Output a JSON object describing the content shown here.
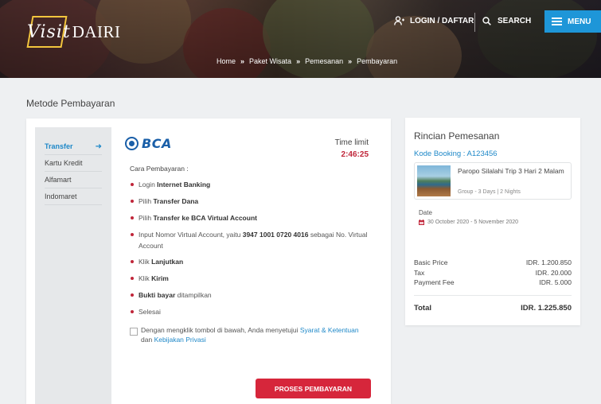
{
  "header": {
    "logo_visit": "Visit",
    "logo_dairi": "DAIRI",
    "login_label": "LOGIN / DAFTAR",
    "search_label": "SEARCH",
    "menu_label": "MENU"
  },
  "breadcrumb": [
    "Home",
    "Paket Wisata",
    "Pemesanan",
    "Pembayaran"
  ],
  "page_title": "Metode Pembayaran",
  "payment": {
    "tabs": [
      {
        "label": "Transfer",
        "active": true
      },
      {
        "label": "Kartu Kredit",
        "active": false
      },
      {
        "label": "Alfamart",
        "active": false
      },
      {
        "label": "Indomaret",
        "active": false
      }
    ],
    "bank_logo": "BCA",
    "time_limit_label": "Time limit",
    "time_limit_value": "2:46:25",
    "instructions_title": "Cara Pembayaran :",
    "agree_prefix": "Dengan mengklik tombol di bawah, Anda menyetujui",
    "agree_link1": "Syarat & Ketentuan",
    "agree_mid": "dan",
    "agree_link2": "Kebijakan Privasi",
    "submit_label": "PROSES PEMBAYARAN"
  },
  "summary": {
    "title": "Rincian Pemesanan",
    "booking_code": "Kode Booking : A123456",
    "trip_name": "Paropo Silalahi Trip 3 Hari 2 Malam",
    "trip_group": "Group - 3 Days | 2 Nights",
    "date_label": "Date",
    "date_value": "30 October 2020 - 5 November 2020",
    "basic_price_label": "Basic Price",
    "basic_price_value": "IDR. 1.200.850",
    "tax_label": "Tax",
    "tax_value": "IDR. 20.000",
    "payment_fee_label": "Payment Fee",
    "payment_fee_value": "IDR. 5.000",
    "total_label": "Total",
    "total_value": "IDR. 1.225.850"
  },
  "colors": {
    "accent_blue": "#1e96d8",
    "accent_red": "#d6263b",
    "logo_gold": "#f2c53d",
    "bca_blue": "#1a5fa8"
  }
}
